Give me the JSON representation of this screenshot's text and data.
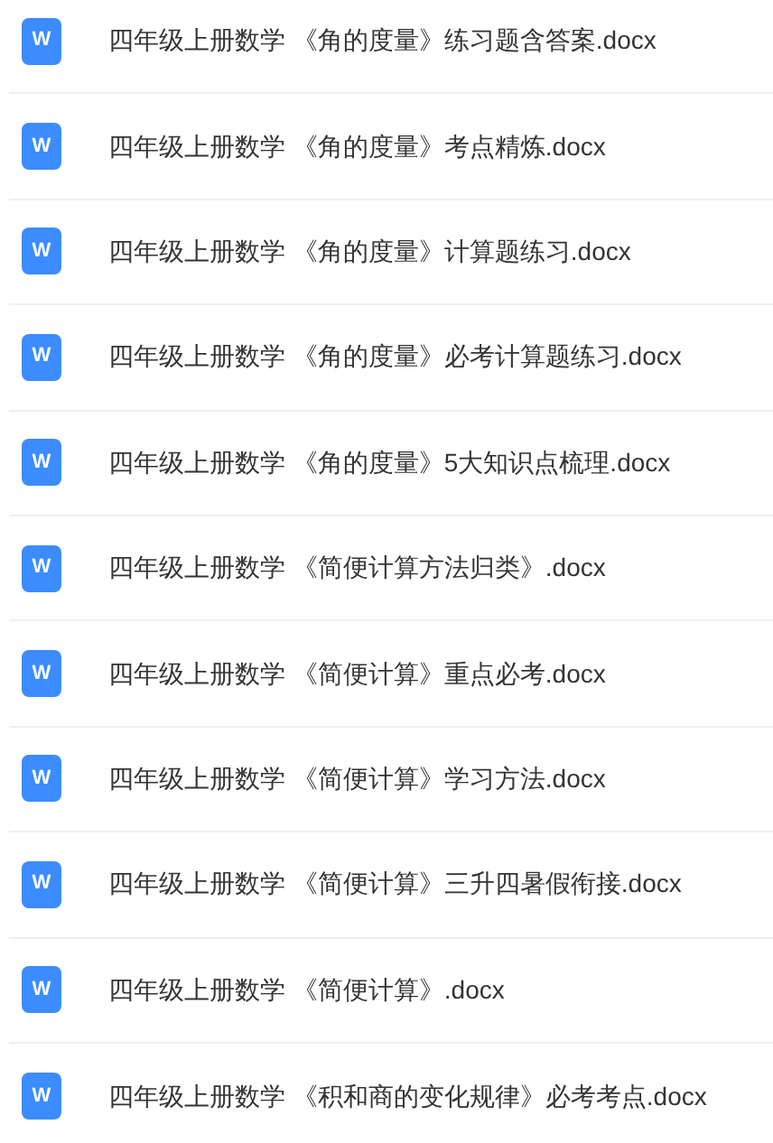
{
  "files": [
    {
      "name": "四年级上册数学 《角的度量》练习题含答案.docx",
      "icon_letter": "W"
    },
    {
      "name": "四年级上册数学 《角的度量》考点精炼.docx",
      "icon_letter": "W"
    },
    {
      "name": "四年级上册数学 《角的度量》计算题练习.docx",
      "icon_letter": "W"
    },
    {
      "name": "四年级上册数学 《角的度量》必考计算题练习.docx",
      "icon_letter": "W"
    },
    {
      "name": "四年级上册数学 《角的度量》5大知识点梳理.docx",
      "icon_letter": "W"
    },
    {
      "name": "四年级上册数学 《简便计算方法归类》.docx",
      "icon_letter": "W"
    },
    {
      "name": "四年级上册数学 《简便计算》重点必考.docx",
      "icon_letter": "W"
    },
    {
      "name": "四年级上册数学 《简便计算》学习方法.docx",
      "icon_letter": "W"
    },
    {
      "name": "四年级上册数学 《简便计算》三升四暑假衔接.docx",
      "icon_letter": "W"
    },
    {
      "name": "四年级上册数学 《简便计算》.docx",
      "icon_letter": "W"
    },
    {
      "name": "四年级上册数学 《积和商的变化规律》必考考点.docx",
      "icon_letter": "W"
    }
  ]
}
